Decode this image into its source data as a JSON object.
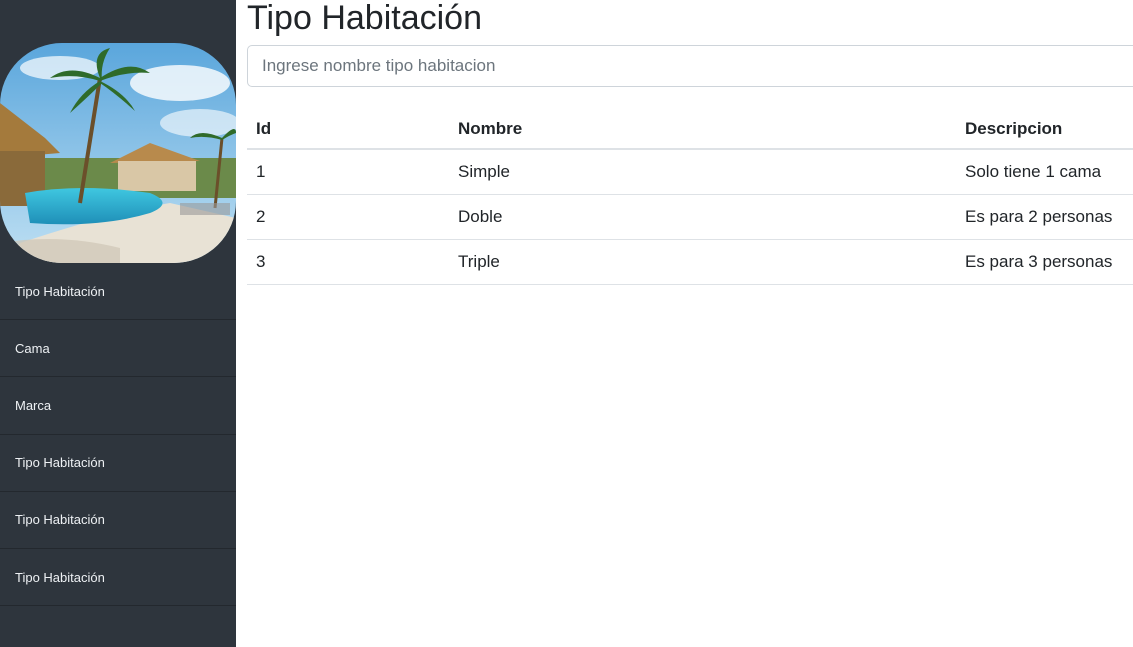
{
  "sidebar": {
    "hero_image": "beach-resort-pool-photo",
    "items": [
      {
        "label": "Tipo Habitación"
      },
      {
        "label": "Cama"
      },
      {
        "label": "Marca"
      },
      {
        "label": "Tipo Habitación"
      },
      {
        "label": "Tipo Habitación"
      },
      {
        "label": "Tipo Habitación"
      }
    ]
  },
  "main": {
    "title": "Tipo Habitación",
    "search_placeholder": "Ingrese nombre tipo habitacion",
    "table": {
      "headers": [
        "Id",
        "Nombre",
        "Descripcion"
      ],
      "rows": [
        [
          "1",
          "Simple",
          "Solo tiene 1 cama"
        ],
        [
          "2",
          "Doble",
          "Es para 2 personas"
        ],
        [
          "3",
          "Triple",
          "Es para 3 personas"
        ]
      ]
    }
  },
  "colors": {
    "sidebar_bg": "#2e353d",
    "sidebar_text": "#eef1f4",
    "text": "#212529",
    "border": "#dee2e6"
  }
}
